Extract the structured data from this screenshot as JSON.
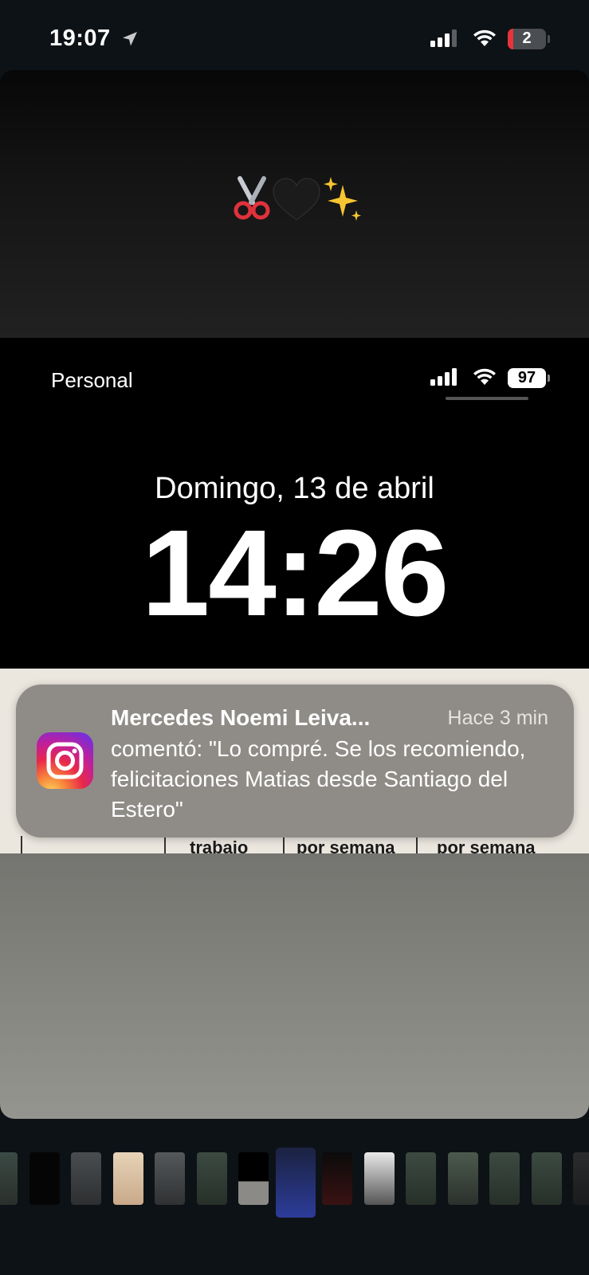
{
  "status_bar": {
    "time": "19:07",
    "battery": "2",
    "icons": [
      "location-arrow-icon",
      "cellular-signal-icon",
      "wifi-icon",
      "battery-icon"
    ]
  },
  "story": {
    "emoji": [
      "scissors-icon",
      "black-heart-icon",
      "sparkles-icon"
    ]
  },
  "preview": {
    "carrier": "Personal",
    "battery": "97",
    "date": "Domingo, 13 de abril",
    "clock": "14:26",
    "table_headers": [
      "trabajo",
      "por semana",
      "por semana"
    ],
    "notification": {
      "app_icon": "instagram-icon",
      "title": "Mercedes Noemi Leiva...",
      "time": "Hace 3 min",
      "body": "comentó: \"Lo compré. Se los recomiendo, felicitaciones  Matias desde Santiago del Estero\""
    }
  },
  "thumbnail_strip": {
    "count": 15,
    "selected_index": 7
  }
}
